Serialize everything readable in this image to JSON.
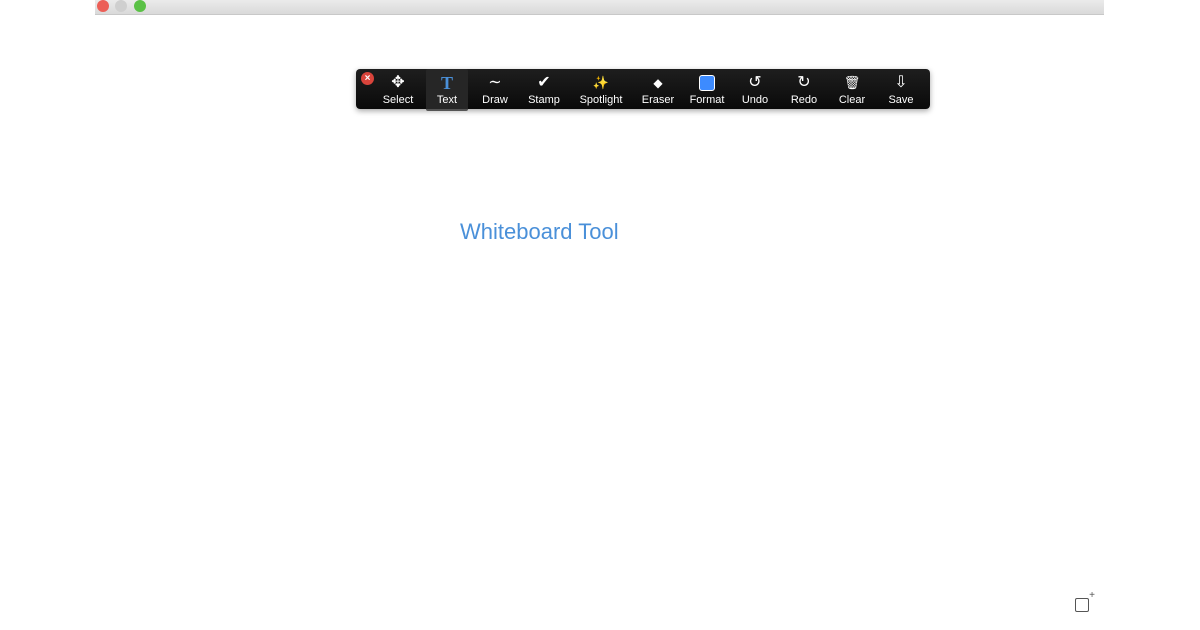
{
  "window": {
    "controls": [
      "close",
      "minimize",
      "zoom"
    ]
  },
  "toolbar": {
    "tools": [
      {
        "label": "Select",
        "icon": "move-arrows-icon"
      },
      {
        "label": "Text",
        "icon": "text-T-icon",
        "active": true
      },
      {
        "label": "Draw",
        "icon": "squiggle-icon"
      },
      {
        "label": "Stamp",
        "icon": "checkmark-icon"
      },
      {
        "label": "Spotlight",
        "icon": "magic-wand-icon"
      },
      {
        "label": "Eraser",
        "icon": "eraser-icon"
      },
      {
        "label": "Format",
        "icon": "color-square-icon",
        "color": "#3d8bff"
      },
      {
        "label": "Undo",
        "icon": "undo-icon"
      },
      {
        "label": "Redo",
        "icon": "redo-icon"
      },
      {
        "label": "Clear",
        "icon": "trash-icon"
      },
      {
        "label": "Save",
        "icon": "save-download-icon"
      }
    ],
    "glyphs": [
      "✥",
      "T",
      "∼",
      "✔",
      "✨",
      "◆",
      "■",
      "↺",
      "↻",
      "🗑",
      "⇩"
    ],
    "close_glyph": "×"
  },
  "canvas": {
    "text": "Whiteboard Tool",
    "text_color": "#4a90d9",
    "corner_glyph": "+"
  }
}
